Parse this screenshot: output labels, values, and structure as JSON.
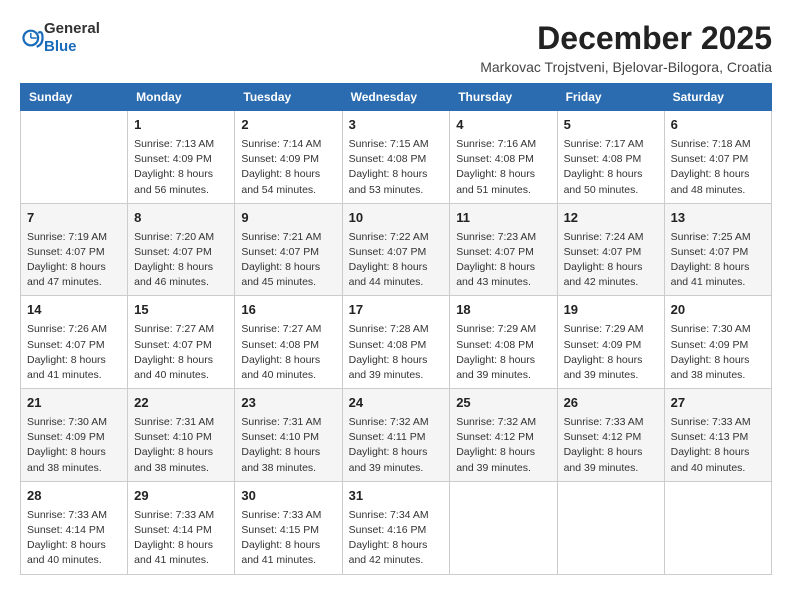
{
  "header": {
    "logo_general": "General",
    "logo_blue": "Blue",
    "month_title": "December 2025",
    "location": "Markovac Trojstveni, Bjelovar-Bilogora, Croatia"
  },
  "days_of_week": [
    "Sunday",
    "Monday",
    "Tuesday",
    "Wednesday",
    "Thursday",
    "Friday",
    "Saturday"
  ],
  "weeks": [
    [
      {
        "day": "",
        "info": ""
      },
      {
        "day": "1",
        "info": "Sunrise: 7:13 AM\nSunset: 4:09 PM\nDaylight: 8 hours\nand 56 minutes."
      },
      {
        "day": "2",
        "info": "Sunrise: 7:14 AM\nSunset: 4:09 PM\nDaylight: 8 hours\nand 54 minutes."
      },
      {
        "day": "3",
        "info": "Sunrise: 7:15 AM\nSunset: 4:08 PM\nDaylight: 8 hours\nand 53 minutes."
      },
      {
        "day": "4",
        "info": "Sunrise: 7:16 AM\nSunset: 4:08 PM\nDaylight: 8 hours\nand 51 minutes."
      },
      {
        "day": "5",
        "info": "Sunrise: 7:17 AM\nSunset: 4:08 PM\nDaylight: 8 hours\nand 50 minutes."
      },
      {
        "day": "6",
        "info": "Sunrise: 7:18 AM\nSunset: 4:07 PM\nDaylight: 8 hours\nand 48 minutes."
      }
    ],
    [
      {
        "day": "7",
        "info": "Sunrise: 7:19 AM\nSunset: 4:07 PM\nDaylight: 8 hours\nand 47 minutes."
      },
      {
        "day": "8",
        "info": "Sunrise: 7:20 AM\nSunset: 4:07 PM\nDaylight: 8 hours\nand 46 minutes."
      },
      {
        "day": "9",
        "info": "Sunrise: 7:21 AM\nSunset: 4:07 PM\nDaylight: 8 hours\nand 45 minutes."
      },
      {
        "day": "10",
        "info": "Sunrise: 7:22 AM\nSunset: 4:07 PM\nDaylight: 8 hours\nand 44 minutes."
      },
      {
        "day": "11",
        "info": "Sunrise: 7:23 AM\nSunset: 4:07 PM\nDaylight: 8 hours\nand 43 minutes."
      },
      {
        "day": "12",
        "info": "Sunrise: 7:24 AM\nSunset: 4:07 PM\nDaylight: 8 hours\nand 42 minutes."
      },
      {
        "day": "13",
        "info": "Sunrise: 7:25 AM\nSunset: 4:07 PM\nDaylight: 8 hours\nand 41 minutes."
      }
    ],
    [
      {
        "day": "14",
        "info": "Sunrise: 7:26 AM\nSunset: 4:07 PM\nDaylight: 8 hours\nand 41 minutes."
      },
      {
        "day": "15",
        "info": "Sunrise: 7:27 AM\nSunset: 4:07 PM\nDaylight: 8 hours\nand 40 minutes."
      },
      {
        "day": "16",
        "info": "Sunrise: 7:27 AM\nSunset: 4:08 PM\nDaylight: 8 hours\nand 40 minutes."
      },
      {
        "day": "17",
        "info": "Sunrise: 7:28 AM\nSunset: 4:08 PM\nDaylight: 8 hours\nand 39 minutes."
      },
      {
        "day": "18",
        "info": "Sunrise: 7:29 AM\nSunset: 4:08 PM\nDaylight: 8 hours\nand 39 minutes."
      },
      {
        "day": "19",
        "info": "Sunrise: 7:29 AM\nSunset: 4:09 PM\nDaylight: 8 hours\nand 39 minutes."
      },
      {
        "day": "20",
        "info": "Sunrise: 7:30 AM\nSunset: 4:09 PM\nDaylight: 8 hours\nand 38 minutes."
      }
    ],
    [
      {
        "day": "21",
        "info": "Sunrise: 7:30 AM\nSunset: 4:09 PM\nDaylight: 8 hours\nand 38 minutes."
      },
      {
        "day": "22",
        "info": "Sunrise: 7:31 AM\nSunset: 4:10 PM\nDaylight: 8 hours\nand 38 minutes."
      },
      {
        "day": "23",
        "info": "Sunrise: 7:31 AM\nSunset: 4:10 PM\nDaylight: 8 hours\nand 38 minutes."
      },
      {
        "day": "24",
        "info": "Sunrise: 7:32 AM\nSunset: 4:11 PM\nDaylight: 8 hours\nand 39 minutes."
      },
      {
        "day": "25",
        "info": "Sunrise: 7:32 AM\nSunset: 4:12 PM\nDaylight: 8 hours\nand 39 minutes."
      },
      {
        "day": "26",
        "info": "Sunrise: 7:33 AM\nSunset: 4:12 PM\nDaylight: 8 hours\nand 39 minutes."
      },
      {
        "day": "27",
        "info": "Sunrise: 7:33 AM\nSunset: 4:13 PM\nDaylight: 8 hours\nand 40 minutes."
      }
    ],
    [
      {
        "day": "28",
        "info": "Sunrise: 7:33 AM\nSunset: 4:14 PM\nDaylight: 8 hours\nand 40 minutes."
      },
      {
        "day": "29",
        "info": "Sunrise: 7:33 AM\nSunset: 4:14 PM\nDaylight: 8 hours\nand 41 minutes."
      },
      {
        "day": "30",
        "info": "Sunrise: 7:33 AM\nSunset: 4:15 PM\nDaylight: 8 hours\nand 41 minutes."
      },
      {
        "day": "31",
        "info": "Sunrise: 7:34 AM\nSunset: 4:16 PM\nDaylight: 8 hours\nand 42 minutes."
      },
      {
        "day": "",
        "info": ""
      },
      {
        "day": "",
        "info": ""
      },
      {
        "day": "",
        "info": ""
      }
    ]
  ]
}
